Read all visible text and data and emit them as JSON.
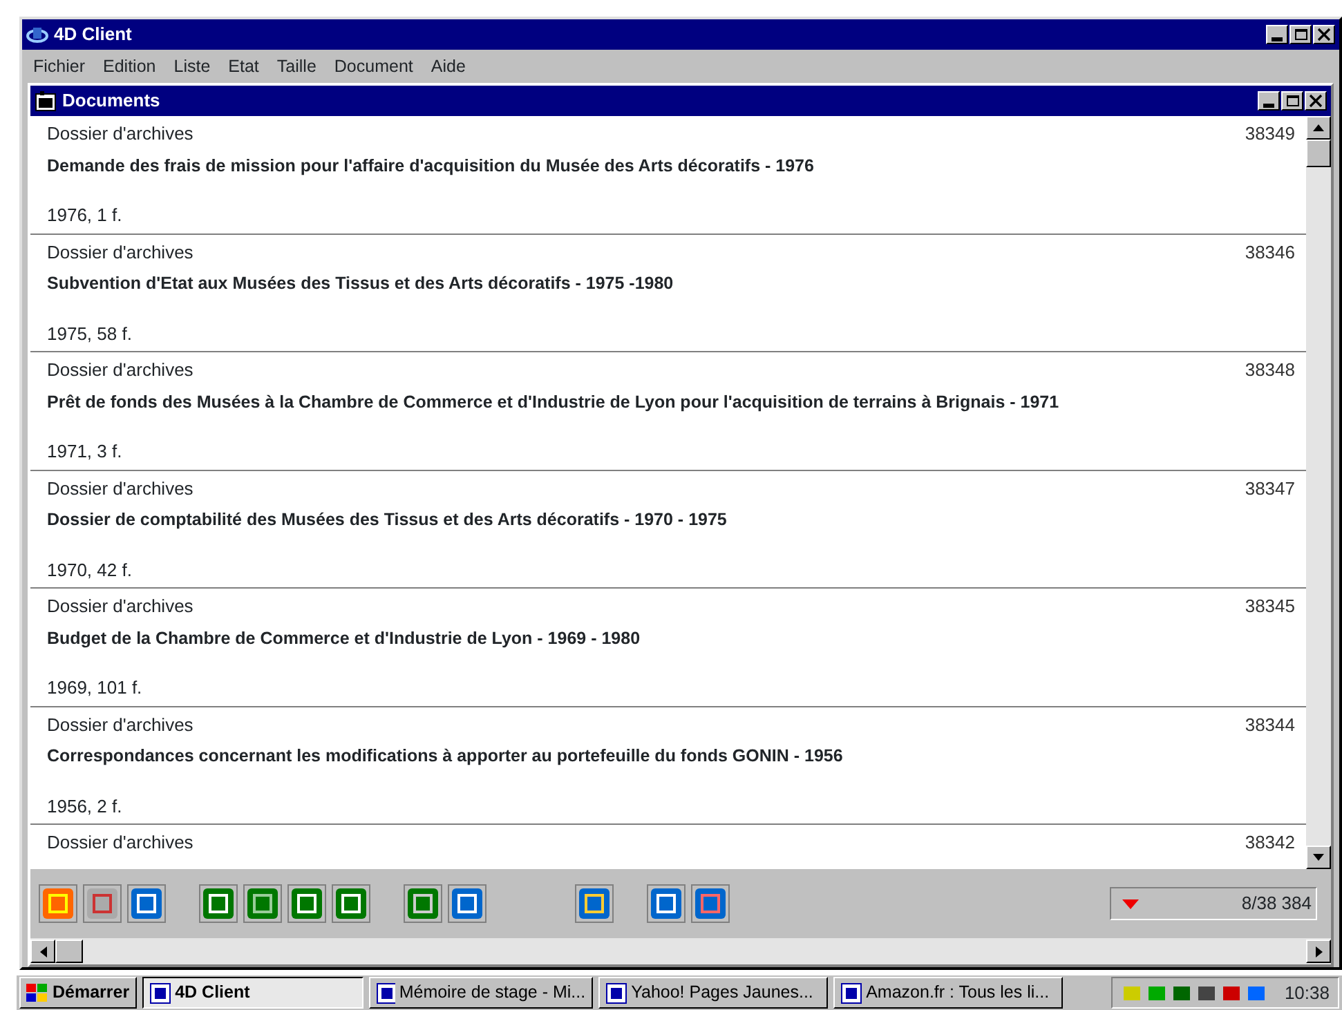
{
  "window": {
    "title": "4D Client"
  },
  "menu": [
    "Fichier",
    "Edition",
    "Liste",
    "Etat",
    "Taille",
    "Document",
    "Aide"
  ],
  "document_window": {
    "title": "Documents"
  },
  "records": [
    {
      "type": "Dossier d'archives",
      "number": "38349",
      "title": "Demande des frais de mission pour l'affaire d'acquisition du Musée des Arts décoratifs - 1976",
      "extent": "1976, 1 f."
    },
    {
      "type": "Dossier d'archives",
      "number": "38346",
      "title": "Subvention d'Etat aux Musées des Tissus et des Arts décoratifs - 1975 -1980",
      "extent": "1975, 58 f."
    },
    {
      "type": "Dossier d'archives",
      "number": "38348",
      "title": "Prêt de fonds des Musées à la Chambre de Commerce et d'Industrie de Lyon pour l'acquisition de terrains à Brignais - 1971",
      "extent": "1971, 3 f."
    },
    {
      "type": "Dossier d'archives",
      "number": "38347",
      "title": "Dossier de comptabilité des Musées des Tissus et des Arts décoratifs - 1970 - 1975",
      "extent": "1970, 42 f."
    },
    {
      "type": "Dossier d'archives",
      "number": "38345",
      "title": "Budget de la Chambre de Commerce et d'Industrie de Lyon - 1969 - 1980",
      "extent": "1969, 101 f."
    },
    {
      "type": "Dossier d'archives",
      "number": "38344",
      "title": "Correspondances concernant les modifications à apporter au portefeuille du fonds GONIN - 1956",
      "extent": "1956, 2 f."
    },
    {
      "type": "Dossier d'archives",
      "number": "38342"
    }
  ],
  "record_counter": "8/38 384",
  "taskbar": {
    "start": "Démarrer",
    "tasks": [
      {
        "label": "4D Client",
        "selected": true
      },
      {
        "label": "Mémoire de stage - Mi...",
        "selected": false
      },
      {
        "label": "Yahoo! Pages Jaunes...",
        "selected": false
      },
      {
        "label": "Amazon.fr : Tous les li...",
        "selected": false
      }
    ],
    "clock": "10:38"
  }
}
